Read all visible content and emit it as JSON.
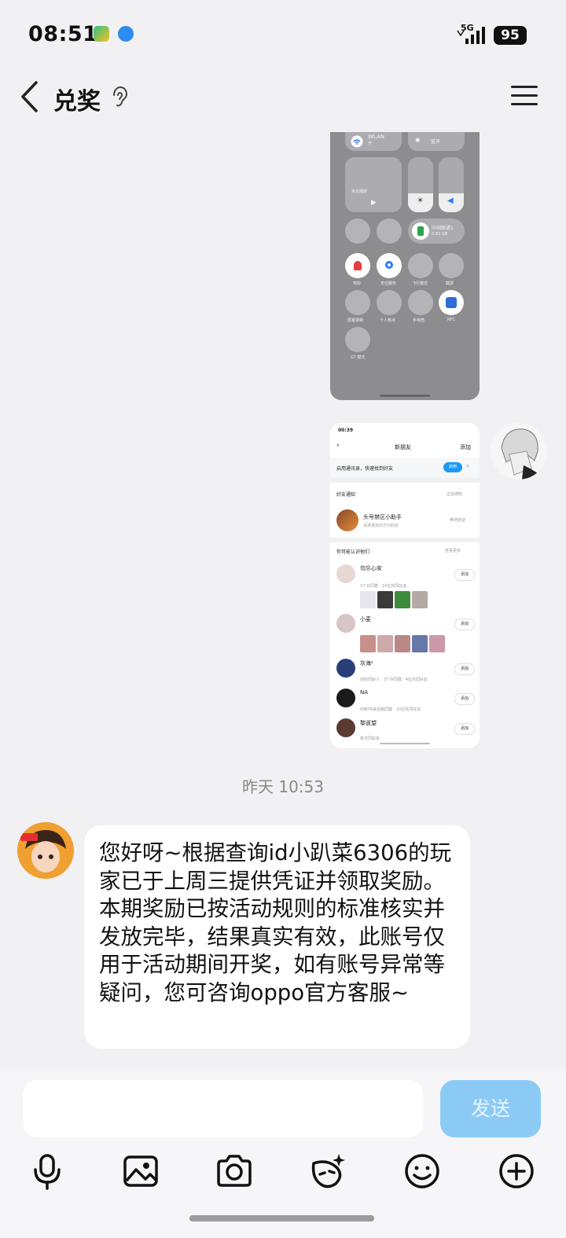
{
  "status": {
    "time": "08:51",
    "network": "5G",
    "battery": "95"
  },
  "nav": {
    "title": "兑奖"
  },
  "shot1": {
    "wlan": "WLAN",
    "wlan_sub": "开",
    "bt": "蓝牙",
    "media": "未在播放",
    "carrier": "中国联通1",
    "carrier_sub": "0.82 GB",
    "labels": [
      "响铃",
      "定位服务",
      "飞行模式",
      "截屏",
      "屏幕录制",
      "个人热点",
      "手电筒",
      "NFC",
      "GT 模式"
    ]
  },
  "shot2": {
    "time": "00:39",
    "title": "新朋友",
    "add": "添加",
    "banner": "启用通讯录，快速找到好友",
    "banner_btn": "启用",
    "notify_title": "好友通知",
    "notify_more": "过滤通知",
    "notify_name": "头号禁区小助手",
    "notify_sub": "请求添加对方为好友",
    "notify_status": "等待验证",
    "know_title": "你可能认识他们",
    "know_more": "查看更多",
    "people": [
      {
        "name": "勿忘心安",
        "sub": "3个共同群 · 10位共同好友",
        "btn": "添加"
      },
      {
        "name": "小麦",
        "sub": "",
        "btn": "添加"
      },
      {
        "name": "灰海²",
        "sub": "你的同龄人 · 3个共同群 · 4位共同好友",
        "btn": "添加"
      },
      {
        "name": "NA",
        "sub": "你和TA来自相同群 · 10位共同好友",
        "btn": "添加"
      },
      {
        "name": "黎逝望",
        "sub": "有共同好友",
        "btn": "添加"
      }
    ]
  },
  "chat": {
    "timestamp": "昨天 10:53",
    "message": "您好呀~根据查询id小趴菜6306的玩家已于上周三提供凭证并领取奖励。本期奖励已按活动规则的标准核实并发放完毕，结果真实有效，此账号仅用于活动期间开奖，如有账号异常等疑问，您可咨询oppo官方客服~"
  },
  "input": {
    "value": "",
    "send": "发送"
  },
  "toolbar": [
    "mic-icon",
    "image-icon",
    "camera-icon",
    "sticker-icon",
    "emoji-icon",
    "plus-icon"
  ],
  "colors": {
    "accent": "#8ccaf6",
    "bubble": "#ffffff",
    "background": "#f1f1f3"
  }
}
